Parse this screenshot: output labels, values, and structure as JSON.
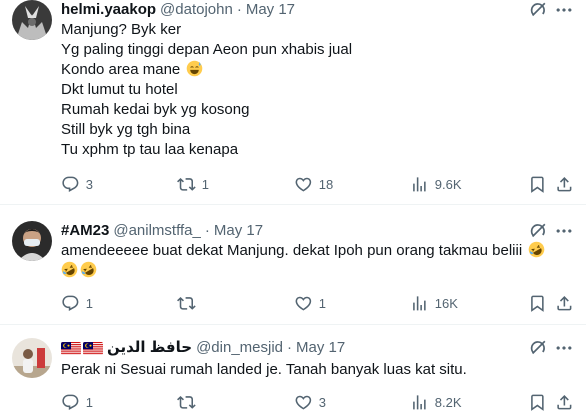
{
  "tweets": [
    {
      "name": "helmi.yaakop",
      "handle": "@datojohn",
      "separator": "·",
      "date": "May 17",
      "lines": [
        "Manjung? Byk ker",
        "Yg paling tinggi depan Aeon pun xhabis jual",
        "Kondo area mane",
        "Dkt lumut tu hotel",
        "Rumah kedai byk yg kosong",
        "Still byk yg tgh bina",
        "Tu xphm tp tau laa kenapa"
      ],
      "replies": "3",
      "reposts": "1",
      "likes": "18",
      "views": "9.6K"
    },
    {
      "name": "#AM23",
      "handle": "@anilmstffa_",
      "separator": "·",
      "date": "May 17",
      "lines": [
        "amendeeeee buat dekat Manjung. dekat Ipoh pun orang takmau beliii"
      ],
      "replies": "1",
      "reposts": "",
      "likes": "1",
      "views": "16K"
    },
    {
      "name": "حافظ الدين",
      "handle": "@din_mesjid",
      "separator": "·",
      "date": "May 17",
      "lines": [
        "Perak ni Sesuai rumah landed je. Tanah banyak luas kat situ."
      ],
      "replies": "1",
      "reposts": "",
      "likes": "3",
      "views": "8.2K"
    }
  ],
  "icons": {
    "reply": "reply-icon",
    "repost": "repost-icon",
    "like": "like-icon",
    "views": "views-icon",
    "bookmark": "bookmark-icon",
    "share": "share-icon",
    "grok": "grok-icon",
    "more": "more-icon"
  },
  "colors": {
    "text": "#0f1419",
    "secondary": "#536471",
    "divider": "#eff3f4"
  }
}
